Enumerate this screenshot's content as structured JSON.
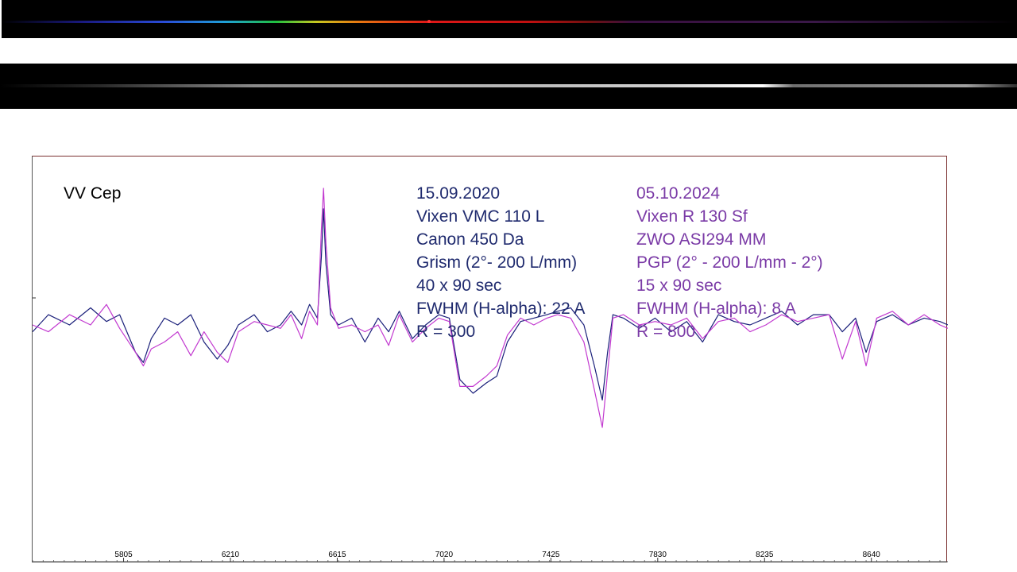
{
  "chart_data": {
    "type": "line",
    "title": "VV Cep",
    "x_ticks": [
      5805,
      6210,
      6615,
      7020,
      7425,
      7830,
      8235,
      8640
    ],
    "xlim": [
      5460,
      8930
    ],
    "ylim": [
      0,
      1
    ],
    "legend_blocks": [
      {
        "color": "#1f2a6e",
        "lines": [
          "15.09.2020",
          "Vixen VMC 110 L",
          "Canon 450 Da",
          "Grism (2°- 200 L/mm)",
          "40 x 90 sec",
          "FWHM (H-alpha): 22 A",
          "R = 300"
        ]
      },
      {
        "color": "#7a3aa6",
        "lines": [
          "05.10.2024",
          "Vixen R 130 Sf",
          "ZWO ASI294 MM",
          "PGP (2° - 200 L/mm - 2°)",
          "15 x 90 sec",
          "FWHM (H-alpha): 8 A",
          "R = 800"
        ]
      }
    ],
    "series": [
      {
        "color": "#1a1f7a",
        "x": [
          5460,
          5520,
          5600,
          5680,
          5740,
          5790,
          5850,
          5880,
          5910,
          5960,
          6010,
          6060,
          6110,
          6160,
          6200,
          6240,
          6300,
          6350,
          6400,
          6440,
          6480,
          6510,
          6540,
          6555,
          6563,
          6572,
          6590,
          6620,
          6670,
          6720,
          6770,
          6810,
          6850,
          6900,
          6950,
          7000,
          7040,
          7080,
          7130,
          7180,
          7220,
          7260,
          7310,
          7360,
          7410,
          7450,
          7500,
          7550,
          7590,
          7620,
          7640,
          7660,
          7700,
          7760,
          7820,
          7880,
          7940,
          8000,
          8060,
          8120,
          8180,
          8240,
          8300,
          8360,
          8420,
          8480,
          8530,
          8580,
          8620,
          8660,
          8720,
          8780,
          8840,
          8900,
          8930
        ],
        "y": [
          0.58,
          0.63,
          0.6,
          0.65,
          0.61,
          0.63,
          0.52,
          0.49,
          0.56,
          0.62,
          0.6,
          0.63,
          0.55,
          0.5,
          0.54,
          0.6,
          0.63,
          0.58,
          0.6,
          0.64,
          0.6,
          0.66,
          0.62,
          0.8,
          0.94,
          0.78,
          0.63,
          0.6,
          0.62,
          0.55,
          0.62,
          0.58,
          0.64,
          0.56,
          0.6,
          0.63,
          0.62,
          0.44,
          0.4,
          0.43,
          0.45,
          0.55,
          0.61,
          0.62,
          0.63,
          0.64,
          0.65,
          0.6,
          0.48,
          0.38,
          0.52,
          0.63,
          0.62,
          0.59,
          0.62,
          0.58,
          0.61,
          0.55,
          0.63,
          0.61,
          0.6,
          0.62,
          0.64,
          0.6,
          0.63,
          0.63,
          0.58,
          0.62,
          0.52,
          0.61,
          0.63,
          0.6,
          0.62,
          0.61,
          0.6
        ]
      },
      {
        "color": "#c23ad0",
        "x": [
          5460,
          5520,
          5600,
          5680,
          5740,
          5790,
          5850,
          5880,
          5910,
          5960,
          6010,
          6060,
          6110,
          6160,
          6200,
          6240,
          6300,
          6350,
          6400,
          6440,
          6480,
          6510,
          6540,
          6555,
          6563,
          6572,
          6590,
          6620,
          6670,
          6720,
          6770,
          6810,
          6850,
          6900,
          6950,
          7000,
          7040,
          7080,
          7130,
          7180,
          7220,
          7260,
          7310,
          7360,
          7410,
          7450,
          7500,
          7550,
          7590,
          7620,
          7640,
          7660,
          7700,
          7760,
          7820,
          7880,
          7940,
          8000,
          8060,
          8120,
          8180,
          8240,
          8300,
          8360,
          8420,
          8480,
          8530,
          8580,
          8620,
          8660,
          8720,
          8780,
          8840,
          8900,
          8930
        ],
        "y": [
          0.6,
          0.58,
          0.63,
          0.6,
          0.66,
          0.59,
          0.52,
          0.48,
          0.53,
          0.55,
          0.58,
          0.51,
          0.58,
          0.52,
          0.49,
          0.58,
          0.61,
          0.6,
          0.59,
          0.63,
          0.56,
          0.64,
          0.6,
          0.88,
          1.0,
          0.84,
          0.65,
          0.59,
          0.6,
          0.58,
          0.6,
          0.54,
          0.63,
          0.55,
          0.59,
          0.62,
          0.61,
          0.42,
          0.42,
          0.45,
          0.48,
          0.57,
          0.62,
          0.6,
          0.62,
          0.63,
          0.62,
          0.55,
          0.41,
          0.3,
          0.46,
          0.62,
          0.63,
          0.6,
          0.61,
          0.6,
          0.62,
          0.56,
          0.61,
          0.62,
          0.58,
          0.6,
          0.63,
          0.61,
          0.62,
          0.63,
          0.5,
          0.61,
          0.48,
          0.62,
          0.64,
          0.6,
          0.63,
          0.6,
          0.59
        ]
      }
    ]
  }
}
